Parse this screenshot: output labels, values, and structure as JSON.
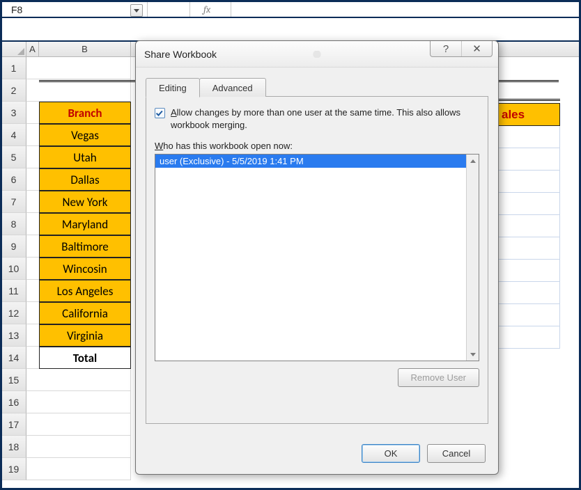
{
  "formula_bar": {
    "cell_ref": "F8",
    "fx_label": "fx",
    "formula_value": ""
  },
  "columns": {
    "A": "A",
    "B": "B"
  },
  "rows": [
    "1",
    "2",
    "3",
    "4",
    "5",
    "6",
    "7",
    "8",
    "9",
    "10",
    "11",
    "12",
    "13",
    "14",
    "15",
    "16",
    "17",
    "18",
    "19"
  ],
  "sheet": {
    "header": "Branch",
    "right_header_fragment": "ales",
    "data": [
      "Vegas",
      "Utah",
      "Dallas",
      "New York",
      "Maryland",
      "Baltimore",
      "Wincosin",
      "Los Angeles",
      "California",
      "Virginia"
    ],
    "total_label": "Total"
  },
  "dialog": {
    "title": "Share Workbook",
    "help_glyph": "?",
    "close_glyph": "✕",
    "tabs": {
      "editing": "Editing",
      "advanced": "Advanced"
    },
    "allow_label_pre": "A",
    "allow_label_rest": "llow changes by more than one user at the same time.  This also allows workbook merging.",
    "who_pre": "W",
    "who_rest": "ho has this workbook open now:",
    "users": [
      "user (Exclusive) - 5/5/2019 1:41 PM"
    ],
    "remove_user": "Remove User",
    "ok": "OK",
    "cancel": "Cancel"
  }
}
